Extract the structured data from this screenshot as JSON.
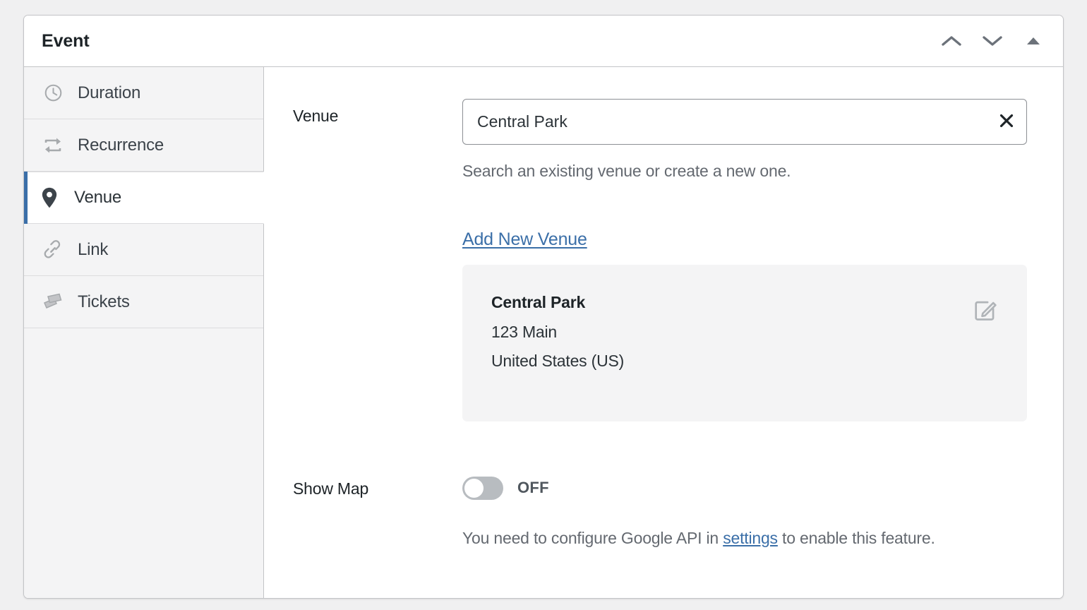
{
  "panel": {
    "title": "Event",
    "header_actions": [
      {
        "name": "move-up-button",
        "icon": "chevron-up-icon"
      },
      {
        "name": "move-down-button",
        "icon": "chevron-down-icon"
      },
      {
        "name": "collapse-panel-button",
        "icon": "triangle-up-icon"
      }
    ]
  },
  "sidebar": {
    "items": [
      {
        "label": "Duration",
        "icon": "clock-icon",
        "active": false
      },
      {
        "label": "Recurrence",
        "icon": "repeat-icon",
        "active": false
      },
      {
        "label": "Venue",
        "icon": "map-pin-icon",
        "active": true
      },
      {
        "label": "Link",
        "icon": "link-chain-icon",
        "active": false
      },
      {
        "label": "Tickets",
        "icon": "tickets-icon",
        "active": false
      }
    ]
  },
  "content": {
    "venue_field": {
      "label": "Venue",
      "value": "Central Park",
      "placeholder": "Search an existing venue or create a new one.",
      "clear_icon": "close-x-icon",
      "help": "Search an existing venue or create a new one."
    },
    "add_new_venue_label": "Add New Venue",
    "venue_card": {
      "name": "Central Park",
      "address": "123 Main",
      "country": "United States (US)",
      "edit_icon": "edit-pencil-square-icon"
    },
    "show_map": {
      "label": "Show Map",
      "state": "OFF",
      "enabled": false,
      "help_prefix": "You need to configure Google API in ",
      "help_link": "settings",
      "help_suffix": " to enable this feature."
    }
  },
  "annotation": {
    "type": "hand-drawn-arrow",
    "direction": "up-right",
    "color": "#e8291f",
    "points_to": "edit-pencil-square-icon"
  },
  "colors": {
    "page_bg": "#f0f0f1",
    "panel_bg": "#ffffff",
    "panel_border": "#c3c4c7",
    "sidebar_bg": "#f4f4f5",
    "active_accent": "#3b6fa8",
    "link": "#3b6fa8",
    "text_dark": "#1d2327",
    "text_muted": "#646970",
    "card_bg": "#f4f4f5",
    "toggle_off": "#b8bcc0",
    "annotation_red": "#e8291f"
  }
}
